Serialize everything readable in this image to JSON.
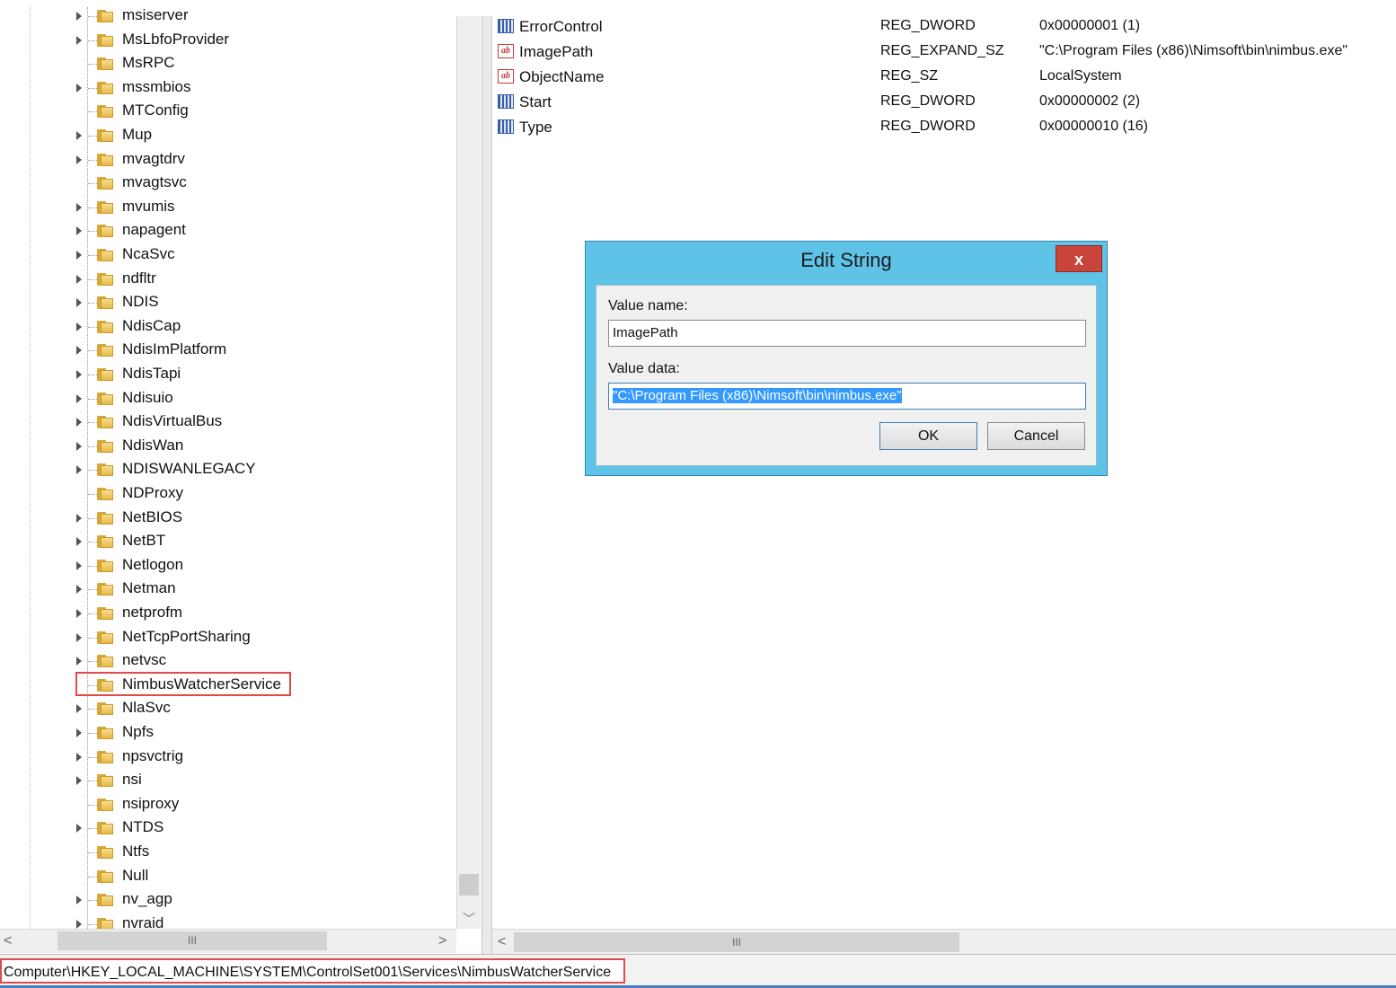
{
  "tree": {
    "items": [
      {
        "label": "msiserver",
        "expandable": true
      },
      {
        "label": "MsLbfoProvider",
        "expandable": true
      },
      {
        "label": "MsRPC",
        "expandable": false
      },
      {
        "label": "mssmbios",
        "expandable": true
      },
      {
        "label": "MTConfig",
        "expandable": false
      },
      {
        "label": "Mup",
        "expandable": true
      },
      {
        "label": "mvagtdrv",
        "expandable": true
      },
      {
        "label": "mvagtsvc",
        "expandable": false
      },
      {
        "label": "mvumis",
        "expandable": true
      },
      {
        "label": "napagent",
        "expandable": true
      },
      {
        "label": "NcaSvc",
        "expandable": true
      },
      {
        "label": "ndfltr",
        "expandable": true
      },
      {
        "label": "NDIS",
        "expandable": true
      },
      {
        "label": "NdisCap",
        "expandable": true
      },
      {
        "label": "NdisImPlatform",
        "expandable": true
      },
      {
        "label": "NdisTapi",
        "expandable": true
      },
      {
        "label": "Ndisuio",
        "expandable": true
      },
      {
        "label": "NdisVirtualBus",
        "expandable": true
      },
      {
        "label": "NdisWan",
        "expandable": true
      },
      {
        "label": "NDISWANLEGACY",
        "expandable": true
      },
      {
        "label": "NDProxy",
        "expandable": false
      },
      {
        "label": "NetBIOS",
        "expandable": true
      },
      {
        "label": "NetBT",
        "expandable": true
      },
      {
        "label": "Netlogon",
        "expandable": true
      },
      {
        "label": "Netman",
        "expandable": true
      },
      {
        "label": "netprofm",
        "expandable": true
      },
      {
        "label": "NetTcpPortSharing",
        "expandable": true
      },
      {
        "label": "netvsc",
        "expandable": true
      },
      {
        "label": "NimbusWatcherService",
        "expandable": false,
        "highlighted": true
      },
      {
        "label": "NlaSvc",
        "expandable": true
      },
      {
        "label": "Npfs",
        "expandable": true
      },
      {
        "label": "npsvctrig",
        "expandable": true
      },
      {
        "label": "nsi",
        "expandable": true
      },
      {
        "label": "nsiproxy",
        "expandable": false
      },
      {
        "label": "NTDS",
        "expandable": true
      },
      {
        "label": "Ntfs",
        "expandable": false
      },
      {
        "label": "Null",
        "expandable": false
      },
      {
        "label": "nv_agp",
        "expandable": true
      },
      {
        "label": "nvraid",
        "expandable": true
      }
    ],
    "scroll_thumb_glyph": "III",
    "scroll_left_glyph": "<",
    "scroll_right_glyph": ">",
    "scroll_down_glyph": "﹀"
  },
  "values": {
    "rows": [
      {
        "icon": "binary-value-icon",
        "name": "ErrorControl",
        "type": "REG_DWORD",
        "data": "0x00000001 (1)"
      },
      {
        "icon": "string-value-icon",
        "name": "ImagePath",
        "type": "REG_EXPAND_SZ",
        "data": "\"C:\\Program Files (x86)\\Nimsoft\\bin\\nimbus.exe\""
      },
      {
        "icon": "string-value-icon",
        "name": "ObjectName",
        "type": "REG_SZ",
        "data": "LocalSystem"
      },
      {
        "icon": "binary-value-icon",
        "name": "Start",
        "type": "REG_DWORD",
        "data": "0x00000002 (2)"
      },
      {
        "icon": "binary-value-icon",
        "name": "Type",
        "type": "REG_DWORD",
        "data": "0x00000010 (16)"
      }
    ],
    "string_icon_glyph": "ab",
    "scroll_thumb_glyph": "III",
    "scroll_left_glyph": "<"
  },
  "status_bar": {
    "path": "Computer\\HKEY_LOCAL_MACHINE\\SYSTEM\\ControlSet001\\Services\\NimbusWatcherService"
  },
  "dialog": {
    "title": "Edit String",
    "close_glyph": "x",
    "value_name_label": "Value name:",
    "value_name": "ImagePath",
    "value_data_label": "Value data:",
    "value_data": "\"C:\\Program Files (x86)\\Nimsoft\\bin\\nimbus.exe\"",
    "ok_label": "OK",
    "cancel_label": "Cancel"
  },
  "colors": {
    "dialog_frame": "#5fc3e8",
    "close_button": "#c9443a",
    "highlight_box": "#e04a4a",
    "selection": "#3399ff"
  }
}
